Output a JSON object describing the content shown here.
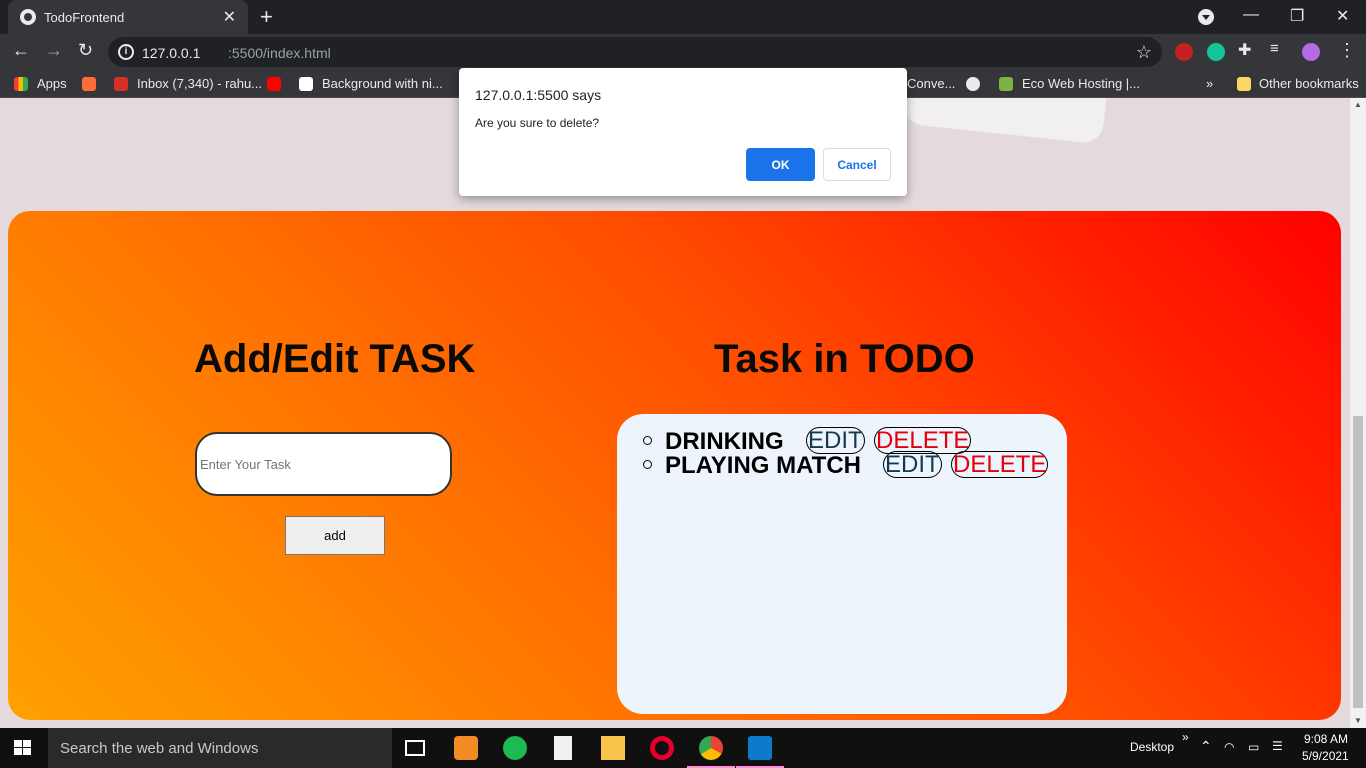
{
  "browser": {
    "tab_title": "TodoFrontend",
    "url_host": "127.0.0.1",
    "url_path": ":5500/index.html",
    "bookmarks": [
      {
        "label": "Apps"
      },
      {
        "label": "Inbox (7,340) - rahu..."
      },
      {
        "label": "Background with ni..."
      },
      {
        "label": "Conve..."
      },
      {
        "label": "Eco Web Hosting |..."
      }
    ],
    "bookmarks_overflow": "»",
    "other_bookmarks": "Other bookmarks"
  },
  "dialog": {
    "title": "127.0.0.1:5500 says",
    "message": "Are you sure to delete?",
    "ok_label": "OK",
    "cancel_label": "Cancel"
  },
  "app": {
    "left_heading": "Add/Edit TASK",
    "right_heading": "Task in TODO",
    "input_placeholder": "Enter Your Task",
    "input_value": "",
    "add_label": "add",
    "tasks": [
      {
        "text": "DRINKING",
        "edit_label": "EDIT",
        "delete_label": "DELETE"
      },
      {
        "text": "PLAYING MATCH",
        "edit_label": "EDIT",
        "delete_label": "DELETE"
      }
    ]
  },
  "taskbar": {
    "search_placeholder": "Search the web and Windows",
    "desktop_label": "Desktop",
    "time": "9:08 AM",
    "date": "5/9/2021"
  },
  "colors": {
    "gradient_start": "#ffa100",
    "gradient_end": "#ff0000",
    "delete_color": "#e3000b",
    "edit_color": "#123a52",
    "ok_button": "#1a73e8"
  }
}
